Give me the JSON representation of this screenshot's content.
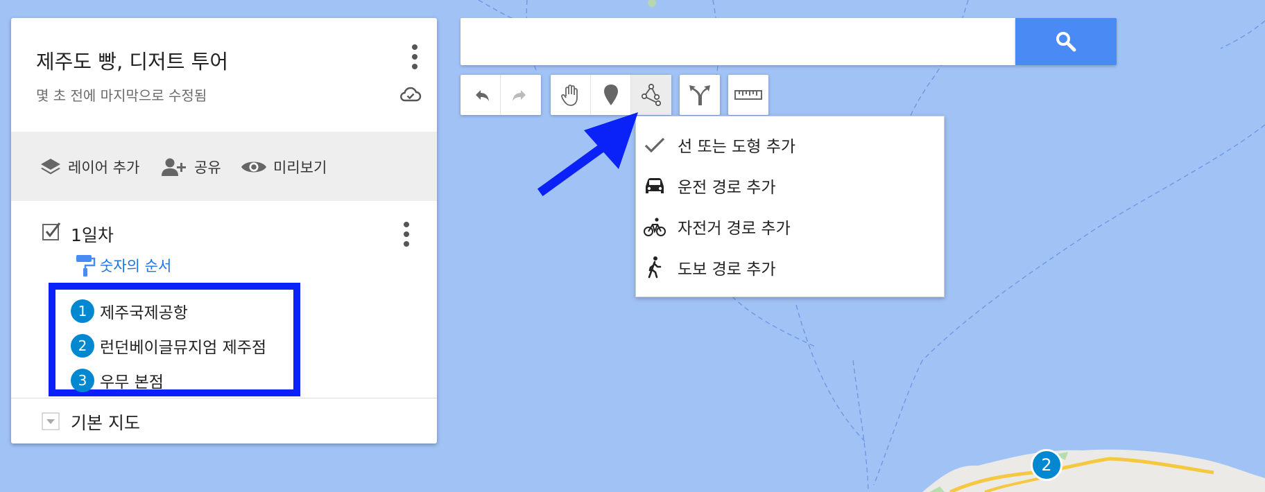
{
  "map": {
    "title": "제주도 빵, 디저트 투어",
    "subtitle": "몇 초 전에 마지막으로 수정됨"
  },
  "actions": {
    "add_layer": "레이어 추가",
    "share": "공유",
    "preview": "미리보기"
  },
  "layer": {
    "title": "1일차",
    "style_label": "숫자의 순서",
    "places": [
      {
        "num": "1",
        "name": "제주국제공항"
      },
      {
        "num": "2",
        "name": "런던베이글뮤지엄 제주점"
      },
      {
        "num": "3",
        "name": "우무 본점"
      }
    ]
  },
  "base_map": {
    "label": "기본 지도"
  },
  "search": {
    "placeholder": ""
  },
  "draw_menu": {
    "items": [
      {
        "label": "선 또는 도형 추가",
        "icon": "check-icon"
      },
      {
        "label": "운전 경로 추가",
        "icon": "car-icon"
      },
      {
        "label": "자전거 경로 추가",
        "icon": "bicycle-icon"
      },
      {
        "label": "도보 경로 추가",
        "icon": "walk-icon"
      }
    ]
  },
  "map_marker": {
    "label": "2"
  },
  "colors": {
    "water": "#a1c2f5",
    "search_button": "#4a8af4",
    "marker": "#0288d1",
    "highlight": "#0a21f7",
    "link": "#1a73e8"
  }
}
